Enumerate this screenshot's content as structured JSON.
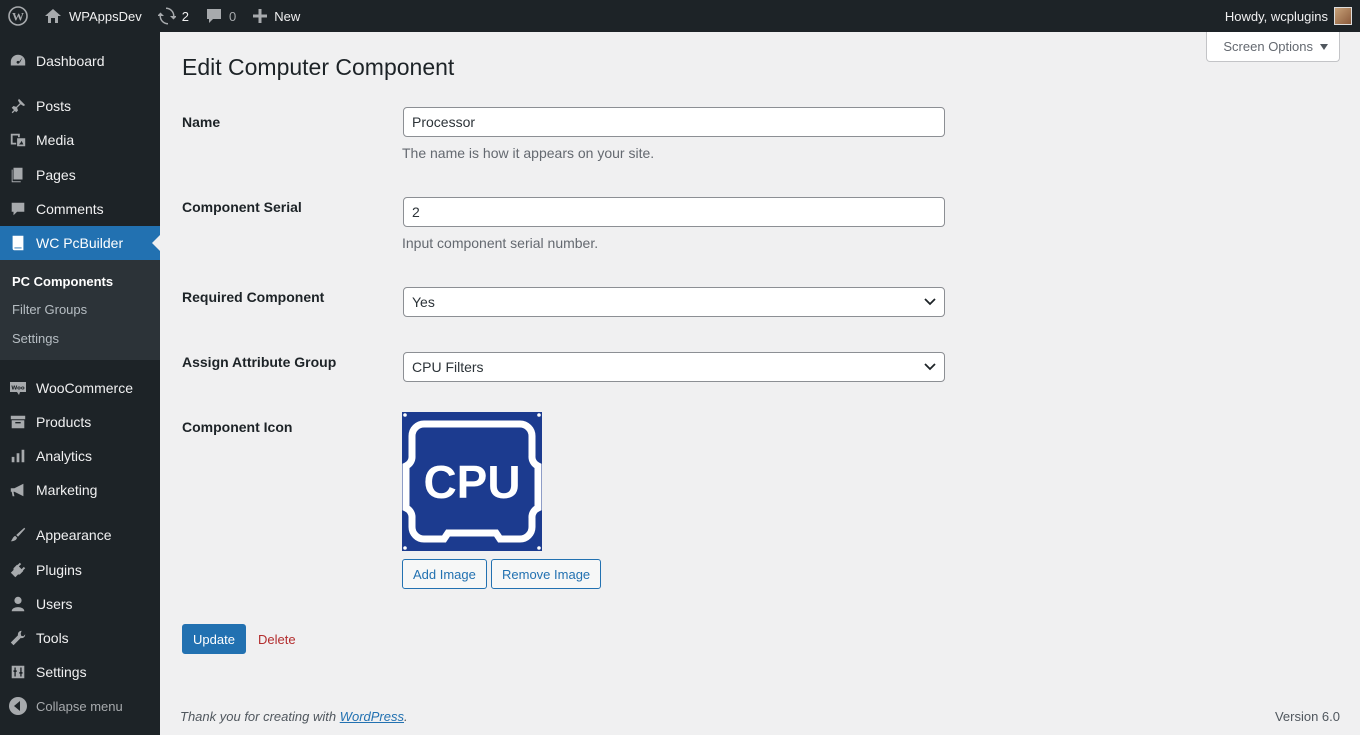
{
  "admin_bar": {
    "site_name": "WPAppsDev",
    "updates_count": "2",
    "comments_count": "0",
    "new_label": "New",
    "howdy": "Howdy, wcplugins"
  },
  "sidebar": {
    "items": [
      {
        "label": "Dashboard",
        "icon": "dashboard-icon"
      },
      {
        "label": "Posts",
        "icon": "pin-icon"
      },
      {
        "label": "Media",
        "icon": "media-icon"
      },
      {
        "label": "Pages",
        "icon": "pages-icon"
      },
      {
        "label": "Comments",
        "icon": "comment-icon"
      },
      {
        "label": "WC PcBuilder",
        "icon": "book-icon"
      },
      {
        "label": "WooCommerce",
        "icon": "woo-icon"
      },
      {
        "label": "Products",
        "icon": "archive-icon"
      },
      {
        "label": "Analytics",
        "icon": "chart-icon"
      },
      {
        "label": "Marketing",
        "icon": "megaphone-icon"
      },
      {
        "label": "Appearance",
        "icon": "brush-icon"
      },
      {
        "label": "Plugins",
        "icon": "plugin-icon"
      },
      {
        "label": "Users",
        "icon": "user-icon"
      },
      {
        "label": "Tools",
        "icon": "wrench-icon"
      },
      {
        "label": "Settings",
        "icon": "settings-icon"
      }
    ],
    "submenu": [
      "PC Components",
      "Filter Groups",
      "Settings"
    ],
    "collapse_label": "Collapse menu"
  },
  "screen_options": "Screen Options",
  "page_title": "Edit Computer Component",
  "form": {
    "name_label": "Name",
    "name_value": "Processor",
    "name_description": "The name is how it appears on your site.",
    "serial_label": "Component Serial",
    "serial_value": "2",
    "serial_description": "Input component serial number.",
    "required_label": "Required Component",
    "required_value": "Yes",
    "attribute_label": "Assign Attribute Group",
    "attribute_value": "CPU Filters",
    "icon_label": "Component Icon",
    "icon_text": "CPU",
    "add_image": "Add Image",
    "remove_image": "Remove Image",
    "update": "Update",
    "delete": "Delete"
  },
  "footer": {
    "thanks_prefix": "Thank you for creating with ",
    "thanks_link": "WordPress",
    "thanks_suffix": ".",
    "version": "Version 6.0"
  },
  "colors": {
    "accent": "#2271b1",
    "admin_dark": "#1d2327",
    "cpu_icon_bg": "#1c3b8f",
    "delete": "#b32d2e"
  }
}
